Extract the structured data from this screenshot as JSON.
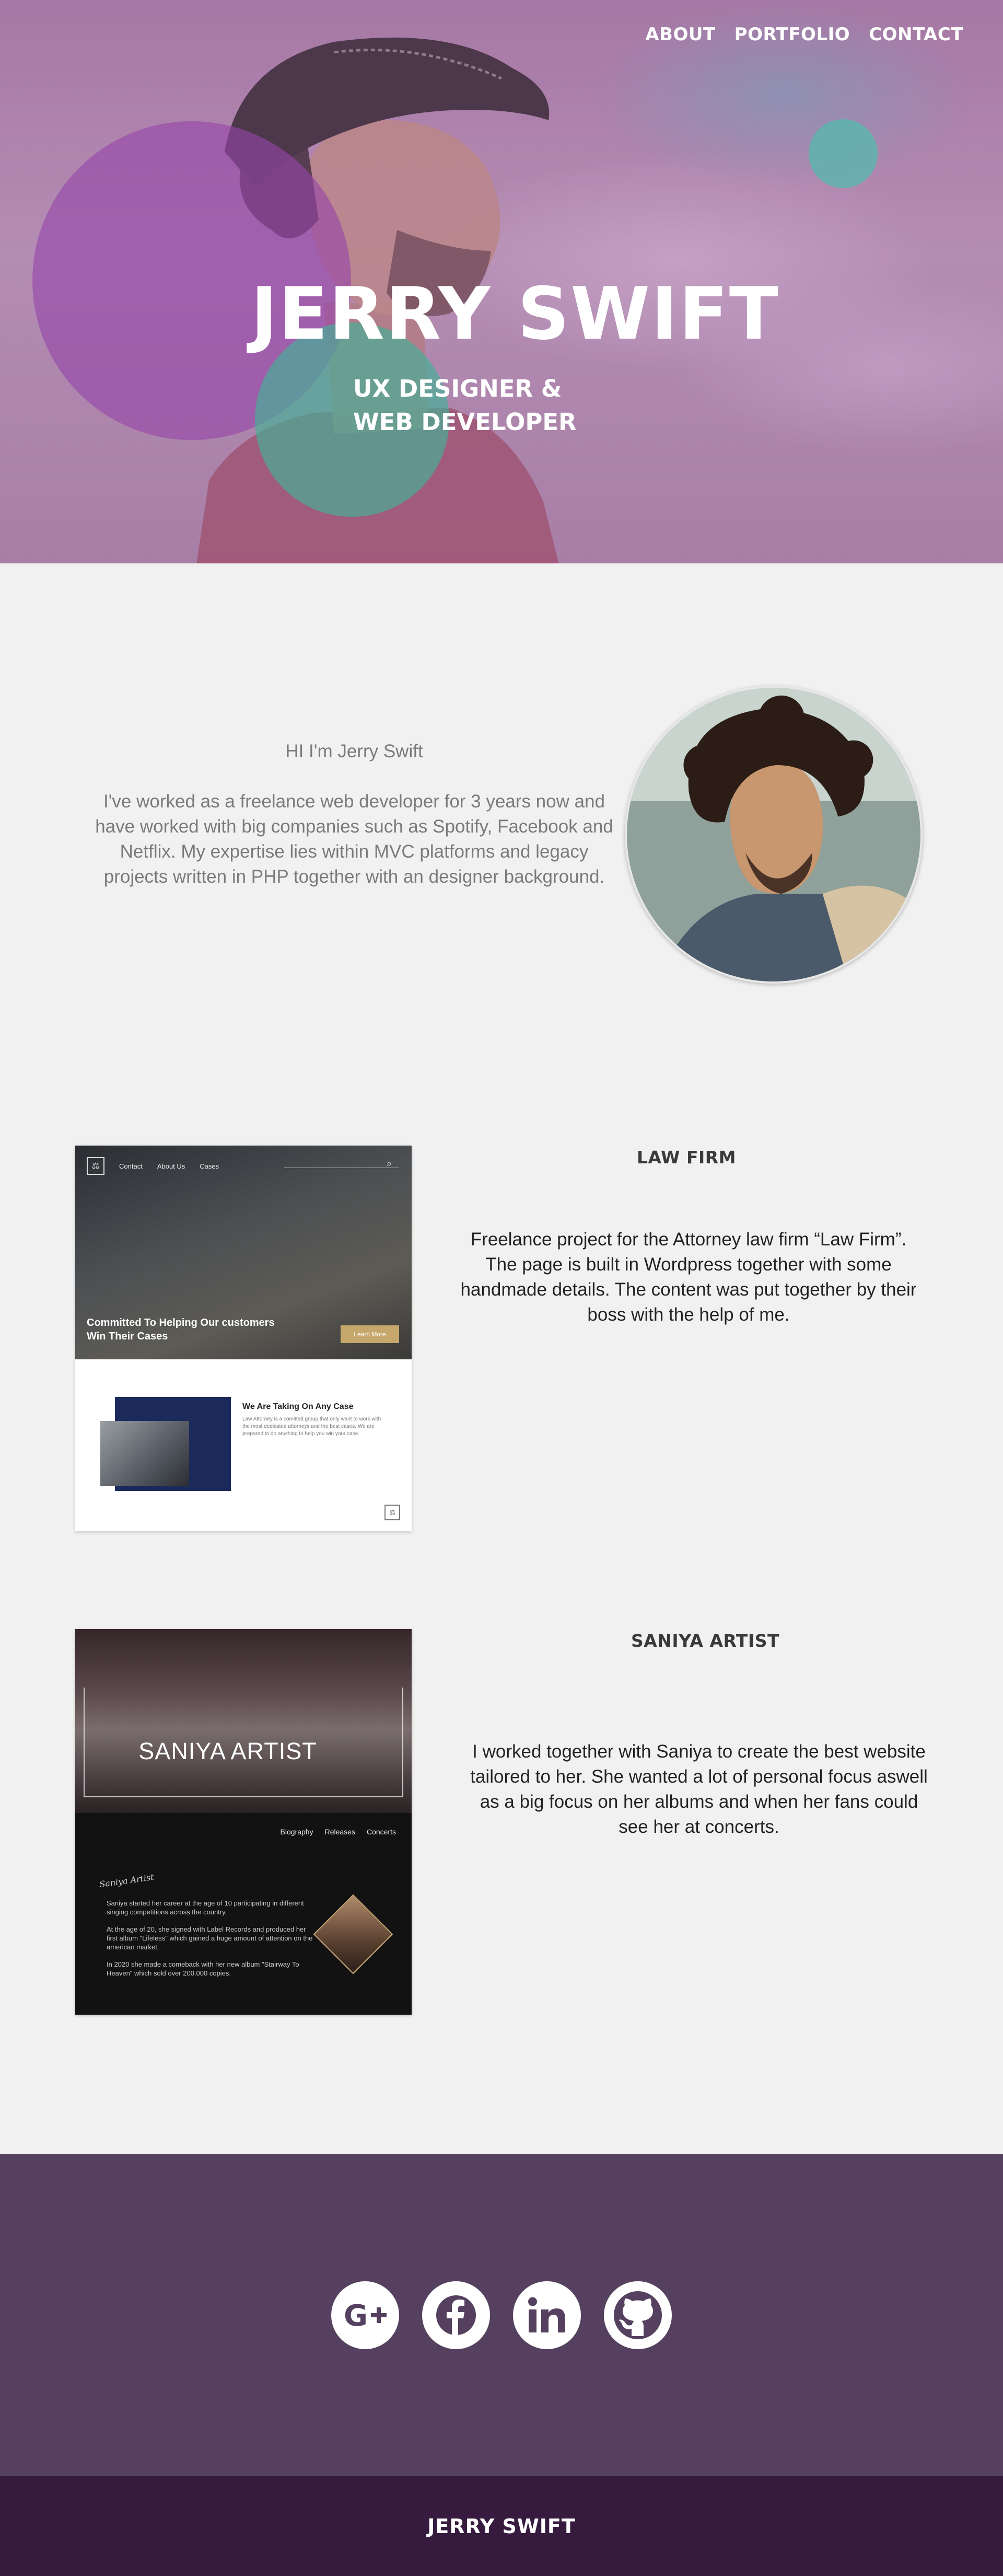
{
  "nav": {
    "about": "ABOUT",
    "portfolio": "PORTFOLIO",
    "contact": "CONTACT"
  },
  "hero": {
    "title": "JERRY SWIFT",
    "subtitle_line1": "UX DESIGNER &",
    "subtitle_line2": "WEB DEVELOPER"
  },
  "about": {
    "greeting": "HI I'm Jerry Swift",
    "body": "I've worked as a freelance web developer for 3 years now and have worked with big companies such as Spotify, Facebook and Netflix. My expertise lies within MVC platforms and legacy projects written in PHP together with an designer background."
  },
  "projects": [
    {
      "title": "LAW FIRM",
      "description": "Freelance project for the Attorney law firm “Law Firm”. The page is built in Wordpress together with some handmade details. The content was put together by their boss with the help of me.",
      "mock": {
        "nav": [
          "Contact",
          "About Us",
          "Cases"
        ],
        "hero_text_line1": "Committed To Helping Our customers",
        "hero_text_line2": "Win Their Cases",
        "button": "Learn More",
        "case_title": "We Are Taking On Any Case",
        "case_body": "Law Attorney is a comitted group that only want to work with the most dedicated attorneys and the best cases. We are prepared to do anything to help you win your case."
      }
    },
    {
      "title": "SANIYA ARTIST",
      "description": "I worked together with Saniya to create the best website tailored to her. She wanted a lot of personal focus aswell as a big focus on her albums and when her fans could see her at concerts.",
      "mock": {
        "title": "SANIYA ARTIST",
        "nav": [
          "Biography",
          "Releases",
          "Concerts"
        ],
        "signature": "Saniya Artist",
        "paragraphs": [
          "Saniya started her career at the age of 10 participating in different singing competitions across the country.",
          "At the age of 20, she signed with Label Records and produced her first album \"Lifeless\" which gained a huge amount of attention on the american market.",
          "In 2020 she made a comeback with her new album \"Stairway To Heaven\" which sold over 200.000 copies."
        ]
      }
    }
  ],
  "social": {
    "icons": [
      "google-plus-icon",
      "facebook-icon",
      "linkedin-icon",
      "github-icon"
    ]
  },
  "footer": {
    "name": "JERRY SWIFT"
  },
  "colors": {
    "social_bg": "#55415f",
    "footer_bg": "#361b3f",
    "accent_teal": "#46af96",
    "accent_purple": "#9646aa"
  }
}
